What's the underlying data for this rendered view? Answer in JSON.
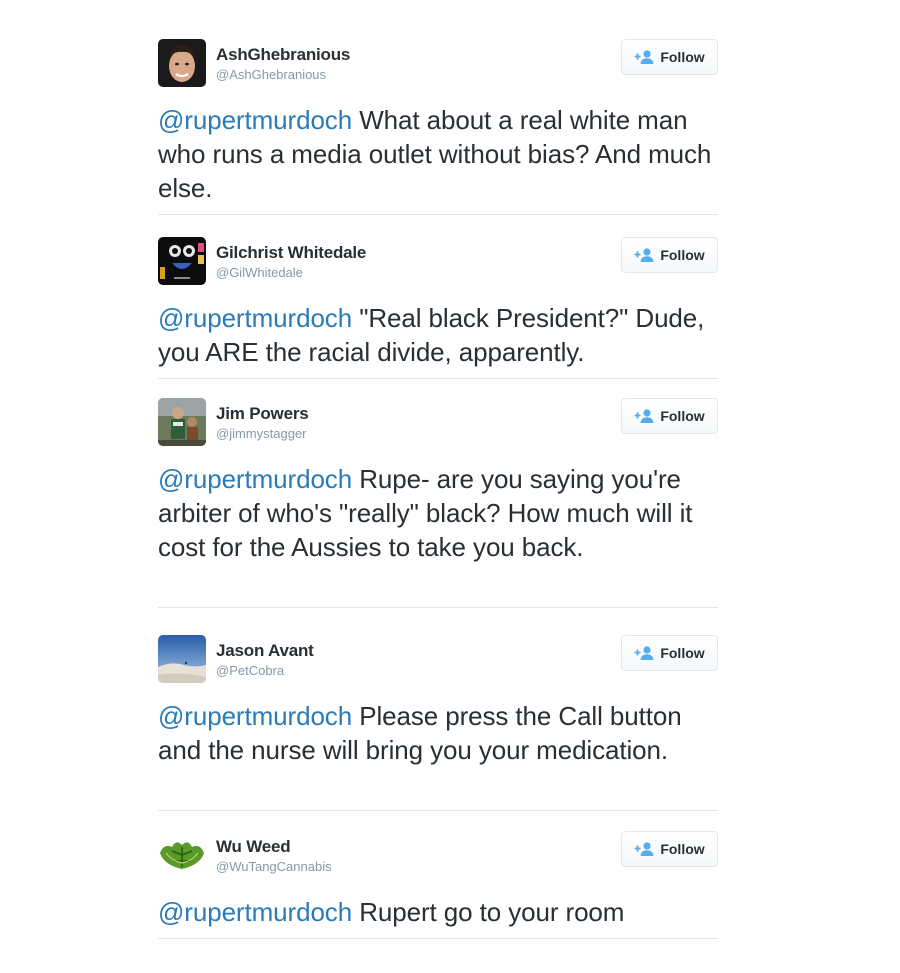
{
  "follow_label": "Follow",
  "colors": {
    "link": "#2b7bb9",
    "text": "#292f33",
    "handle": "#8899a6",
    "divider": "#e1e8ed",
    "follow_icon": "#55acee"
  },
  "tweets": [
    {
      "name": "AshGhebranious",
      "handle": "@AshGhebranious",
      "mention": "@rupertmurdoch",
      "text": " What about a real white man who runs a media outlet without bias? And much else."
    },
    {
      "name": "Gilchrist Whitedale",
      "handle": "@GilWhitedale",
      "mention": "@rupertmurdoch",
      "text": " \"Real black President?\" Dude, you ARE the racial divide, apparently."
    },
    {
      "name": "Jim Powers",
      "handle": "@jimmystagger",
      "mention": "@rupertmurdoch",
      "text": " Rupe- are you saying you're arbiter of who's \"really\" black? How much will it cost for the Aussies to take you back."
    },
    {
      "name": "Jason Avant",
      "handle": "@PetCobra",
      "mention": "@rupertmurdoch",
      "text": " Please press the Call button and the nurse will bring you your medication."
    },
    {
      "name": "Wu Weed",
      "handle": "@WuTangCannabis",
      "mention": "@rupertmurdoch",
      "text": " Rupert go to your room"
    }
  ]
}
